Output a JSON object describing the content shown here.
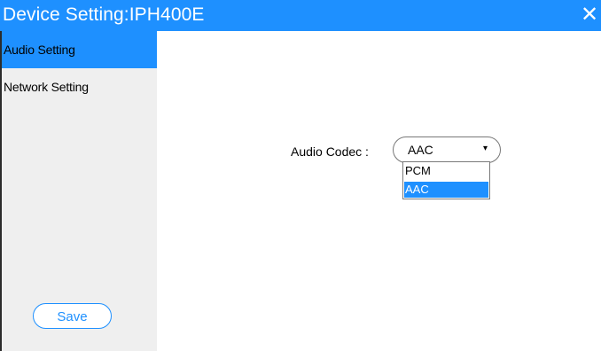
{
  "window": {
    "title": "Device Setting:IPH400E",
    "close_glyph": "✕"
  },
  "sidebar": {
    "items": [
      {
        "label": "Audio Setting",
        "active": true
      },
      {
        "label": "Network Setting",
        "active": false
      }
    ],
    "save_label": "Save"
  },
  "audio": {
    "codec_label": "Audio Codec :",
    "codec_value": "AAC",
    "arrow_glyph": "▾",
    "options": [
      "PCM",
      "AAC"
    ],
    "selected_option": "AAC"
  },
  "colors": {
    "accent": "#1e90ff",
    "sidebar_bg": "#efefef"
  }
}
